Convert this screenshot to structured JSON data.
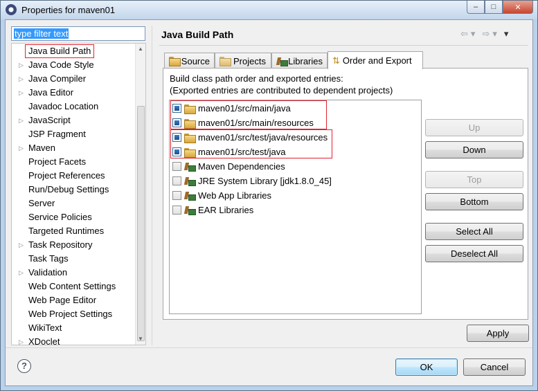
{
  "window": {
    "title": "Properties for maven01",
    "buttons": {
      "minimize": "–",
      "maximize": "□",
      "close": "✕"
    }
  },
  "filter": {
    "text": "type filter text"
  },
  "tree": {
    "items": [
      {
        "label": "Java Build Path",
        "expandable": false,
        "selected": true
      },
      {
        "label": "Java Code Style",
        "expandable": true
      },
      {
        "label": "Java Compiler",
        "expandable": true
      },
      {
        "label": "Java Editor",
        "expandable": true
      },
      {
        "label": "Javadoc Location",
        "expandable": false
      },
      {
        "label": "JavaScript",
        "expandable": true
      },
      {
        "label": "JSP Fragment",
        "expandable": false
      },
      {
        "label": "Maven",
        "expandable": true
      },
      {
        "label": "Project Facets",
        "expandable": false
      },
      {
        "label": "Project References",
        "expandable": false
      },
      {
        "label": "Run/Debug Settings",
        "expandable": false
      },
      {
        "label": "Server",
        "expandable": false
      },
      {
        "label": "Service Policies",
        "expandable": false
      },
      {
        "label": "Targeted Runtimes",
        "expandable": false
      },
      {
        "label": "Task Repository",
        "expandable": true
      },
      {
        "label": "Task Tags",
        "expandable": false
      },
      {
        "label": "Validation",
        "expandable": true
      },
      {
        "label": "Web Content Settings",
        "expandable": false
      },
      {
        "label": "Web Page Editor",
        "expandable": false
      },
      {
        "label": "Web Project Settings",
        "expandable": false
      },
      {
        "label": "WikiText",
        "expandable": false
      },
      {
        "label": "XDoclet",
        "expandable": true
      }
    ]
  },
  "page": {
    "title": "Java Build Path",
    "nav": {
      "back": "⇦",
      "back_menu": "▾",
      "forward": "⇨",
      "forward_menu": "▾",
      "view_menu": "▾"
    }
  },
  "tabs": [
    {
      "label": "Source",
      "icon": "source-folder-icon"
    },
    {
      "label": "Projects",
      "icon": "projects-icon"
    },
    {
      "label": "Libraries",
      "icon": "libraries-icon"
    },
    {
      "label": "Order and Export",
      "icon": "order-export-icon",
      "active": true
    }
  ],
  "order_export": {
    "description_line1": "Build class path order and exported entries:",
    "description_line2": "(Exported entries are contributed to dependent projects)",
    "entries": [
      {
        "label": "maven01/src/main/java",
        "icon": "source-folder-icon",
        "checked": true
      },
      {
        "label": "maven01/src/main/resources",
        "icon": "source-folder-icon",
        "checked": true
      },
      {
        "label": "maven01/src/test/java/resources",
        "icon": "source-folder-icon",
        "checked": true
      },
      {
        "label": "maven01/src/test/java",
        "icon": "source-folder-icon",
        "checked": true
      },
      {
        "label": "Maven Dependencies",
        "icon": "library-icon",
        "checked": false
      },
      {
        "label": "JRE System Library [jdk1.8.0_45]",
        "icon": "library-icon",
        "checked": false
      },
      {
        "label": "Web App Libraries",
        "icon": "library-icon",
        "checked": false
      },
      {
        "label": "EAR Libraries",
        "icon": "library-icon",
        "checked": false
      }
    ],
    "buttons": {
      "up": "Up",
      "down": "Down",
      "top": "Top",
      "bottom": "Bottom",
      "select_all": "Select All",
      "deselect_all": "Deselect All"
    }
  },
  "footer": {
    "help": "?",
    "apply": "Apply",
    "ok": "OK",
    "cancel": "Cancel"
  },
  "colors": {
    "highlight": "#e0222f",
    "selection": "#3399ff"
  }
}
